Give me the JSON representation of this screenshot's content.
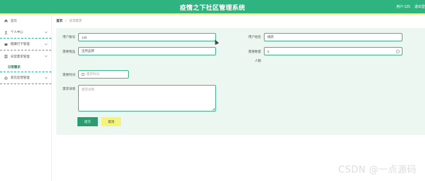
{
  "header": {
    "title": "疫情之下社区管理系统",
    "user_label": "用户:125",
    "logout_label": "退出登"
  },
  "sidebar": {
    "items": [
      {
        "label": "首页",
        "icon": "home-icon"
      },
      {
        "label": "个人中心",
        "icon": "user-icon"
      },
      {
        "label": "健康打卡管理",
        "icon": "card-icon"
      },
      {
        "label": "日常需求管理",
        "icon": "list-icon"
      },
      {
        "label": "日常需求",
        "icon": ""
      },
      {
        "label": "意见反馈管理",
        "icon": "feedback-icon"
      }
    ]
  },
  "breadcrumb": {
    "home": "首页",
    "separator": "/",
    "current": "日常需求"
  },
  "form": {
    "user_account": {
      "label": "用户账号",
      "value": "125"
    },
    "user_name": {
      "label": "用户姓名",
      "value": "姚跃"
    },
    "need_item": {
      "label": "需要物品",
      "value": "出所品牌"
    },
    "need_qty": {
      "label": "需要数量",
      "value": "5",
      "unit": "人数"
    },
    "deliver_time": {
      "label": "需要时间",
      "placeholder": "需求时间"
    },
    "need_content": {
      "label": "需求详情",
      "placeholder": "需求详情"
    }
  },
  "buttons": {
    "submit": "提交",
    "cancel": "取消"
  },
  "watermark": "CSDN @一点源码",
  "colors": {
    "primary": "#2fb481",
    "accent": "#f4f47a",
    "panel": "#ecf7f1"
  }
}
